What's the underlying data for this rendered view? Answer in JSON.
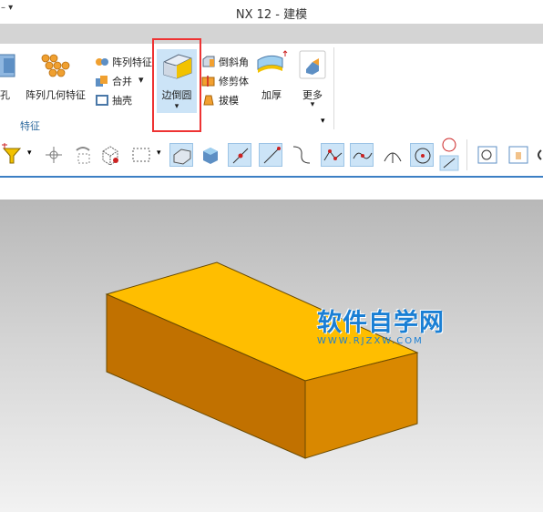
{
  "window": {
    "title": "NX 12 - 建模",
    "quick_access_glyph": "–  ▾"
  },
  "ribbon": {
    "buttons": {
      "hole": "孔",
      "pattern_geometry": "阵列几何特征",
      "pattern_feature": "阵列特征",
      "combine": "合并",
      "shell": "抽壳",
      "edge_blend": "边倒圆",
      "chamfer": "倒斜角",
      "trim_body": "修剪体",
      "draft": "拔模",
      "thicken": "加厚",
      "more": "更多"
    },
    "group_label": "特征",
    "dropdown_glyph": "▾"
  },
  "colors": {
    "accent": "#3c7fc4",
    "highlight_border": "#e33333",
    "box_top": "#ffbe00",
    "box_front": "#cc7a00",
    "box_right": "#d98a00",
    "watermark": "#1a7fd4"
  },
  "watermark": {
    "main": "软件自学网",
    "url": "WWW.RJZXW.COM"
  },
  "icons": {
    "toolbar_snap": [
      "select-filter-icon",
      "point-icon",
      "rotate-icon",
      "cube-select-icon",
      "rect-select-icon",
      "shaded-view-icon",
      "box-view-icon",
      "end-point-icon",
      "line-point-icon",
      "curve-icon",
      "polyline-icon",
      "spline-icon",
      "arc-icon",
      "circle-center-icon",
      "tangent-icon",
      "zoom-icon",
      "pan-icon"
    ]
  }
}
